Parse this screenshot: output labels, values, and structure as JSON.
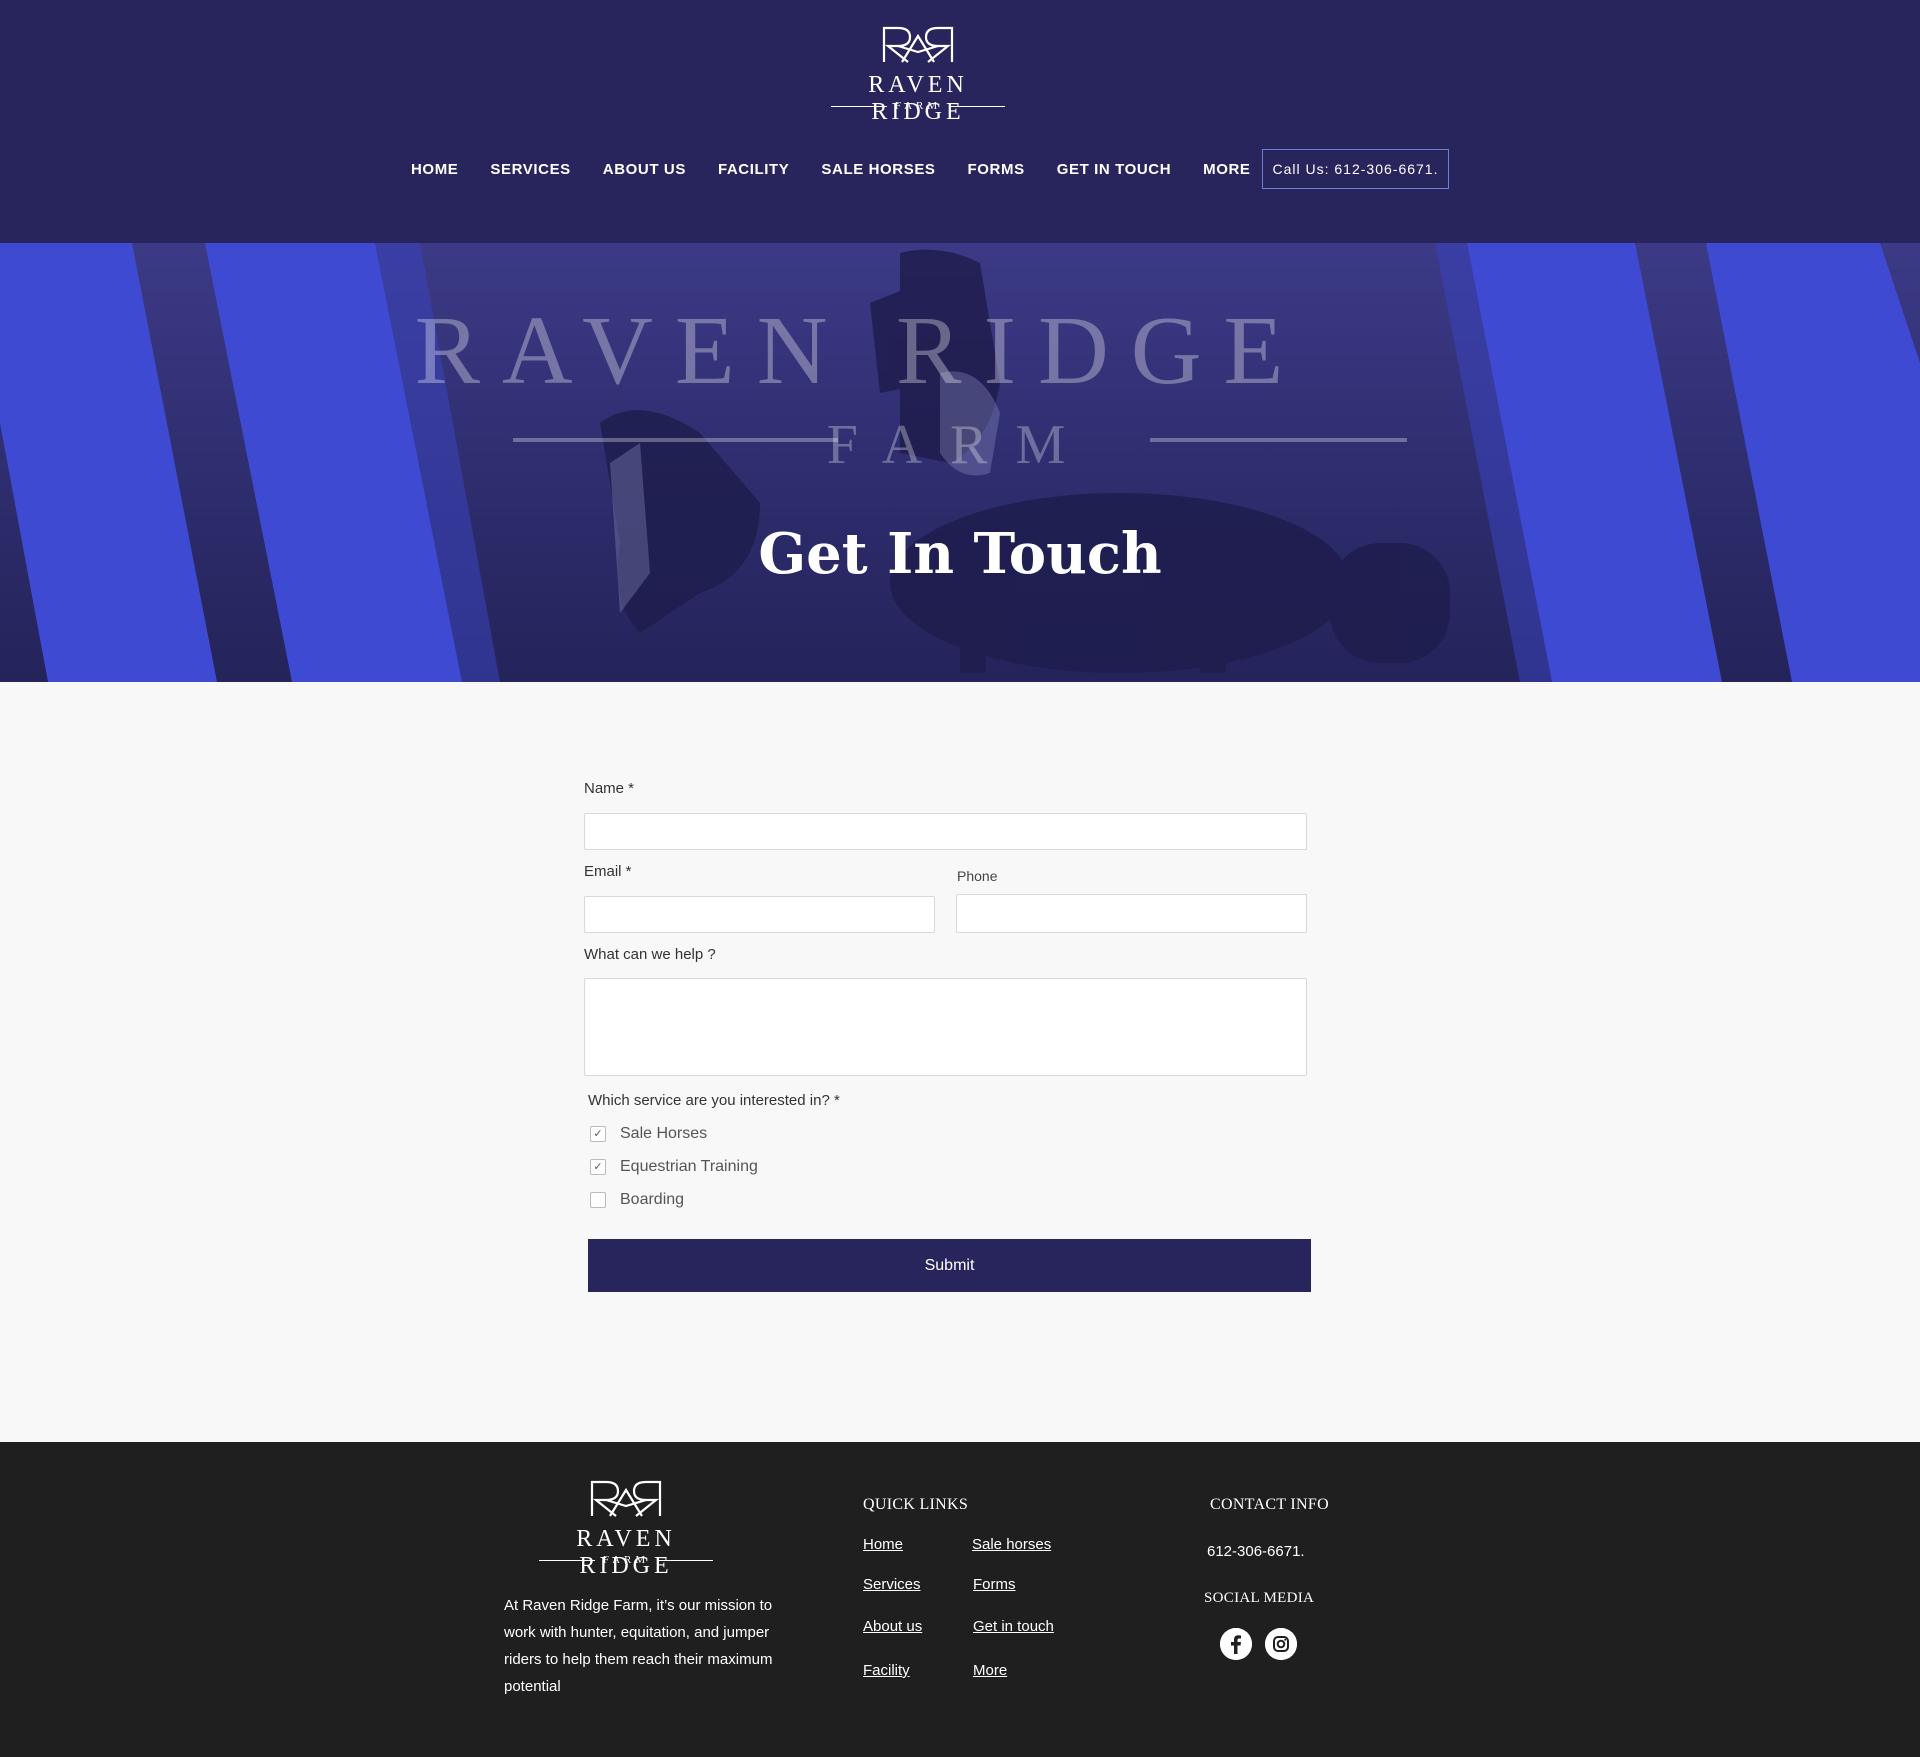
{
  "header": {
    "logo_monogram": "RMR",
    "logo_name": "RAVEN RIDGE",
    "logo_sub": "FARM",
    "nav": [
      "HOME",
      "SERVICES",
      "ABOUT US",
      "FACILITY",
      "SALE HORSES",
      "FORMS",
      "GET IN TOUCH",
      "MORE"
    ],
    "call_button": "Call Us: 612-306-6671."
  },
  "hero": {
    "watermark_name": "RAVEN RIDGE",
    "watermark_sub": "FARM",
    "title": "Get In Touch"
  },
  "form": {
    "name_label": "Name *",
    "email_label": "Email *",
    "phone_label": "Phone",
    "help_label": "What can we help ?",
    "service_label": "Which service are you interested in? *",
    "services": [
      {
        "label": "Sale Horses",
        "checked": true
      },
      {
        "label": "Equestrian Training",
        "checked": true
      },
      {
        "label": "Boarding",
        "checked": false
      }
    ],
    "submit": "Submit"
  },
  "footer": {
    "logo_name": "RAVEN RIDGE",
    "logo_sub": "FARM",
    "description": "At Raven Ridge Farm, it’s our mission to work with hunter, equitation, and jumper riders to help them reach their maximum potential",
    "quick_links_heading": "QUICK LINKS",
    "links": {
      "home": "Home",
      "sale_horses": "Sale horses",
      "services": "Services",
      "forms": "Forms",
      "about": "About us",
      "get_in_touch": "Get in touch",
      "facility": "Facility",
      "more": "More"
    },
    "contact_heading": "CONTACT  INFO",
    "phone": "612-306-6671.",
    "social_heading": "SOCIAL MEDIA",
    "social_icons": [
      "facebook-icon",
      "instagram-icon"
    ]
  },
  "colors": {
    "navy": "#28255c",
    "hero_blue": "#3f4ad3",
    "footer_bg": "#1f1f1f"
  }
}
